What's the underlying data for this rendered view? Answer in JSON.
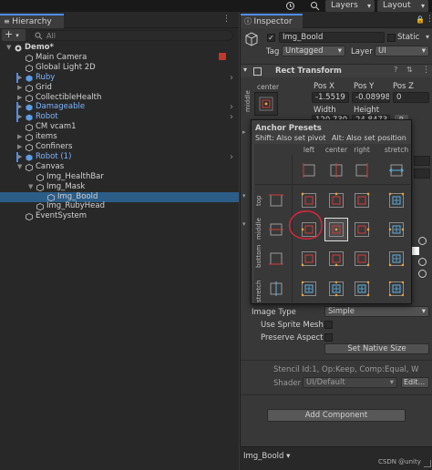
{
  "topbar": {
    "layers_label": "Layers",
    "layout_label": "Layout"
  },
  "hierarchy": {
    "tab_title": "Hierarchy",
    "add_label": "+",
    "search_placeholder": "All",
    "items": [
      {
        "name": "Demo*",
        "indent": 0,
        "type": "scene",
        "expanded": true
      },
      {
        "name": "Main Camera",
        "indent": 1,
        "type": "object"
      },
      {
        "name": "Global Light 2D",
        "indent": 1,
        "type": "object"
      },
      {
        "name": "Ruby",
        "indent": 1,
        "type": "prefab",
        "collapsed": true
      },
      {
        "name": "Grid",
        "indent": 1,
        "type": "object",
        "collapsed": true
      },
      {
        "name": "CollectibleHealth",
        "indent": 1,
        "type": "object",
        "collapsed": true
      },
      {
        "name": "Damageable",
        "indent": 1,
        "type": "prefab",
        "collapsed": true
      },
      {
        "name": "Robot",
        "indent": 1,
        "type": "prefab",
        "collapsed": true
      },
      {
        "name": "CM vcam1",
        "indent": 1,
        "type": "object"
      },
      {
        "name": "items",
        "indent": 1,
        "type": "object",
        "collapsed": true
      },
      {
        "name": "Confiners",
        "indent": 1,
        "type": "object",
        "collapsed": true
      },
      {
        "name": "Robot (1)",
        "indent": 1,
        "type": "prefab",
        "collapsed": true
      },
      {
        "name": "Canvas",
        "indent": 1,
        "type": "object",
        "expanded": true
      },
      {
        "name": "Img_HealthBar",
        "indent": 2,
        "type": "object"
      },
      {
        "name": "Img_Mask",
        "indent": 2,
        "type": "object",
        "expanded": true
      },
      {
        "name": "Img_Boold",
        "indent": 3,
        "type": "object",
        "selected": true
      },
      {
        "name": "Img_RubyHead",
        "indent": 2,
        "type": "object"
      },
      {
        "name": "EventSystem",
        "indent": 1,
        "type": "object"
      }
    ]
  },
  "inspector": {
    "tab_title": "Inspector",
    "object_name": "Img_Boold",
    "static_label": "Static",
    "tag_label": "Tag",
    "tag_value": "Untagged",
    "layer_label": "Layer",
    "layer_value": "UI",
    "rect_transform_title": "Rect Transform",
    "anchor_side_label": "middle",
    "anchor_top_label": "center",
    "pos_x_label": "Pos X",
    "pos_y_label": "Pos Y",
    "pos_z_label": "Pos Z",
    "pos_x": "-1.5519",
    "pos_y": "-0.08998",
    "pos_z": "0",
    "width_label": "Width",
    "height_label": "Height",
    "width_value": "120.7305",
    "height_value": "24.8473",
    "r_button": "R",
    "image_type_label": "Image Type",
    "image_type_value": "Simple",
    "use_sprite_mesh_label": "Use Sprite Mesh",
    "preserve_aspect_label": "Preserve Aspect",
    "set_native_size_label": "Set Native Size",
    "stencil_text": "Stencil Id:1, Op:Keep, Comp:Equal, W",
    "shader_label": "Shader",
    "shader_value": "UI/Default",
    "edit_label": "Edit...",
    "add_component_label": "Add Component",
    "footer_label": "Img_Boold ▾",
    "watermark": "CSDN @unity"
  },
  "anchor_presets": {
    "title": "Anchor Presets",
    "hint_shift": "Shift: Also set pivot",
    "hint_alt": "Alt: Also set position",
    "columns": [
      "left",
      "center",
      "right",
      "stretch"
    ],
    "rows": [
      "top",
      "middle",
      "bottom",
      "stretch"
    ],
    "selected": "middle-center",
    "highlighted": "middle-left"
  },
  "colors": {
    "selection": "#2c5d87",
    "accent": "#4d8cf0",
    "prefab_text": "#7cb4ff",
    "anchor_red": "#d23c3c",
    "anchor_orange": "#e8a23a",
    "anchor_blue": "#5fb4e6",
    "highlight_circle": "#d7263d"
  }
}
